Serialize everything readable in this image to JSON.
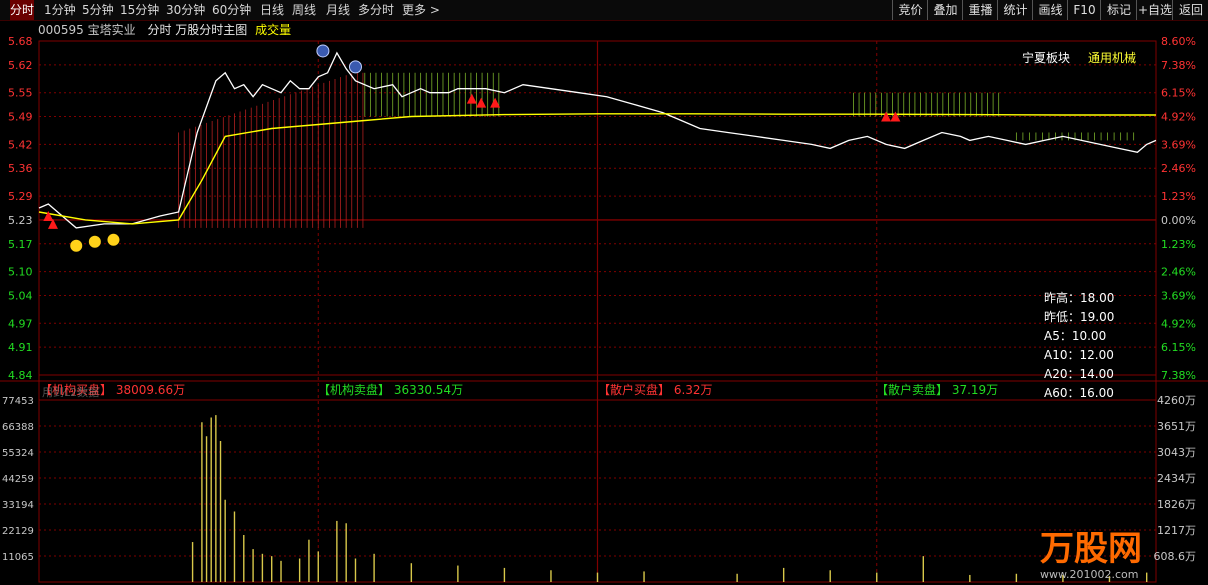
{
  "toolbar": {
    "tabs": [
      "分时",
      "1分钟",
      "5分钟",
      "15分钟",
      "30分钟",
      "60分钟",
      "日线",
      "周线",
      "月线",
      "多分时",
      "更多 >"
    ],
    "active_index": 0,
    "right_buttons": [
      "竞价",
      "叠加",
      "重播",
      "统计",
      "画线",
      "F10",
      "标记",
      "+自选",
      "返回"
    ]
  },
  "info": {
    "code_name": "000595 宝塔实业",
    "view": "分时 万股分时主图",
    "vol_label": "成交量"
  },
  "sector": {
    "label": "宁夏板块",
    "concept": "通用机械"
  },
  "stats": [
    {
      "k": "昨高",
      "v": "18.00"
    },
    {
      "k": "昨低",
      "v": "19.00"
    },
    {
      "k": "A5",
      "v": "10.00"
    },
    {
      "k": "A10",
      "v": "12.00"
    },
    {
      "k": "A20",
      "v": "14.00"
    },
    {
      "k": "A60",
      "v": "16.00"
    }
  ],
  "flow": [
    {
      "label": "【机构买盘】",
      "value": "38009.66万",
      "color": "#ff3333"
    },
    {
      "label": "【机构卖盘】",
      "value": "36330.54万",
      "color": "#22dd22"
    },
    {
      "label": "【散户买盘】",
      "value": "6.32万",
      "color": "#ff3333"
    },
    {
      "label": "【散户卖盘】",
      "value": "37.19万",
      "color": "#22dd22"
    }
  ],
  "vol_sub_label": "用到L2数据",
  "watermark": {
    "text": "万股网",
    "url": "www.201002.com"
  },
  "colors": {
    "up": "#ff3333",
    "down": "#22dd22",
    "price": "#ffffff",
    "avg": "#ffff00",
    "grid": "#800000",
    "bg": "#000000"
  },
  "chart_data": {
    "type": "line",
    "price_axis": {
      "prev_close": 5.23,
      "ticks": [
        5.68,
        5.62,
        5.55,
        5.49,
        5.42,
        5.36,
        5.29,
        5.23,
        5.17,
        5.1,
        5.04,
        4.97,
        4.91,
        4.84
      ],
      "pct_ticks": [
        "8.60%",
        "7.38%",
        "6.15%",
        "4.92%",
        "3.69%",
        "2.46%",
        "1.23%",
        "0.00%",
        "1.23%",
        "2.46%",
        "3.69%",
        "4.92%",
        "6.15%",
        "7.38%"
      ]
    },
    "volume_axis": {
      "ticks": [
        77453,
        66388,
        55324,
        44259,
        33194,
        22129,
        11065
      ],
      "right_ticks": [
        "4260万",
        "3651万",
        "3043万",
        "2434万",
        "1826万",
        "1217万",
        "608.6万"
      ]
    },
    "series": [
      {
        "name": "price",
        "x": [
          0,
          2,
          4,
          8,
          14,
          20,
          26,
          30,
          34,
          38,
          40,
          42,
          44,
          46,
          48,
          50,
          52,
          54,
          56,
          58,
          60,
          62,
          64,
          66,
          68,
          72,
          76,
          78,
          80,
          82,
          84,
          86,
          88,
          90,
          92,
          96,
          100,
          104,
          110,
          116,
          122,
          128,
          134,
          138,
          142,
          148,
          154,
          160,
          166,
          170,
          174,
          178,
          182,
          186,
          190,
          194,
          198,
          200,
          204,
          208,
          212,
          216,
          220,
          224,
          228,
          232,
          236,
          238,
          240
        ],
        "values": [
          5.26,
          5.27,
          5.25,
          5.21,
          5.22,
          5.22,
          5.24,
          5.25,
          5.45,
          5.58,
          5.6,
          5.56,
          5.57,
          5.54,
          5.57,
          5.56,
          5.55,
          5.58,
          5.56,
          5.56,
          5.59,
          5.6,
          5.65,
          5.61,
          5.58,
          5.56,
          5.57,
          5.54,
          5.55,
          5.56,
          5.55,
          5.55,
          5.55,
          5.56,
          5.56,
          5.56,
          5.55,
          5.57,
          5.56,
          5.55,
          5.54,
          5.52,
          5.5,
          5.48,
          5.46,
          5.45,
          5.44,
          5.43,
          5.42,
          5.41,
          5.43,
          5.44,
          5.42,
          5.41,
          5.43,
          5.45,
          5.44,
          5.43,
          5.44,
          5.43,
          5.42,
          5.43,
          5.44,
          5.43,
          5.42,
          5.41,
          5.4,
          5.42,
          5.43
        ]
      },
      {
        "name": "avg",
        "x": [
          0,
          10,
          20,
          30,
          35,
          40,
          50,
          60,
          70,
          80,
          100,
          120,
          140,
          160,
          180,
          200,
          220,
          240
        ],
        "values": [
          5.25,
          5.23,
          5.22,
          5.23,
          5.33,
          5.44,
          5.46,
          5.47,
          5.48,
          5.49,
          5.495,
          5.497,
          5.497,
          5.496,
          5.496,
          5.495,
          5.494,
          5.494
        ]
      }
    ],
    "volume": [
      {
        "x": 33,
        "v": 17000
      },
      {
        "x": 35,
        "v": 68000
      },
      {
        "x": 36,
        "v": 62000
      },
      {
        "x": 37,
        "v": 70000
      },
      {
        "x": 38,
        "v": 71000
      },
      {
        "x": 39,
        "v": 60000
      },
      {
        "x": 40,
        "v": 35000
      },
      {
        "x": 42,
        "v": 30000
      },
      {
        "x": 44,
        "v": 20000
      },
      {
        "x": 46,
        "v": 14000
      },
      {
        "x": 48,
        "v": 12000
      },
      {
        "x": 50,
        "v": 11000
      },
      {
        "x": 52,
        "v": 9000
      },
      {
        "x": 56,
        "v": 10000
      },
      {
        "x": 58,
        "v": 18000
      },
      {
        "x": 60,
        "v": 13000
      },
      {
        "x": 64,
        "v": 26000
      },
      {
        "x": 66,
        "v": 25000
      },
      {
        "x": 68,
        "v": 10000
      },
      {
        "x": 72,
        "v": 12000
      },
      {
        "x": 80,
        "v": 8000
      },
      {
        "x": 90,
        "v": 7000
      },
      {
        "x": 100,
        "v": 6000
      },
      {
        "x": 110,
        "v": 5000
      },
      {
        "x": 120,
        "v": 4000
      },
      {
        "x": 130,
        "v": 4500
      },
      {
        "x": 150,
        "v": 3500
      },
      {
        "x": 160,
        "v": 6000
      },
      {
        "x": 170,
        "v": 5000
      },
      {
        "x": 180,
        "v": 4000
      },
      {
        "x": 190,
        "v": 11000
      },
      {
        "x": 200,
        "v": 3000
      },
      {
        "x": 210,
        "v": 3500
      },
      {
        "x": 220,
        "v": 3000
      },
      {
        "x": 230,
        "v": 2500
      },
      {
        "x": 238,
        "v": 4000
      }
    ],
    "buy_markers": [
      {
        "x": 2,
        "y": 5.24
      },
      {
        "x": 3,
        "y": 5.22
      },
      {
        "x": 93,
        "y": 5.535
      },
      {
        "x": 95,
        "y": 5.525
      },
      {
        "x": 98,
        "y": 5.525
      },
      {
        "x": 182,
        "y": 5.49
      },
      {
        "x": 184,
        "y": 5.49
      }
    ],
    "xlim": [
      0,
      240
    ]
  }
}
